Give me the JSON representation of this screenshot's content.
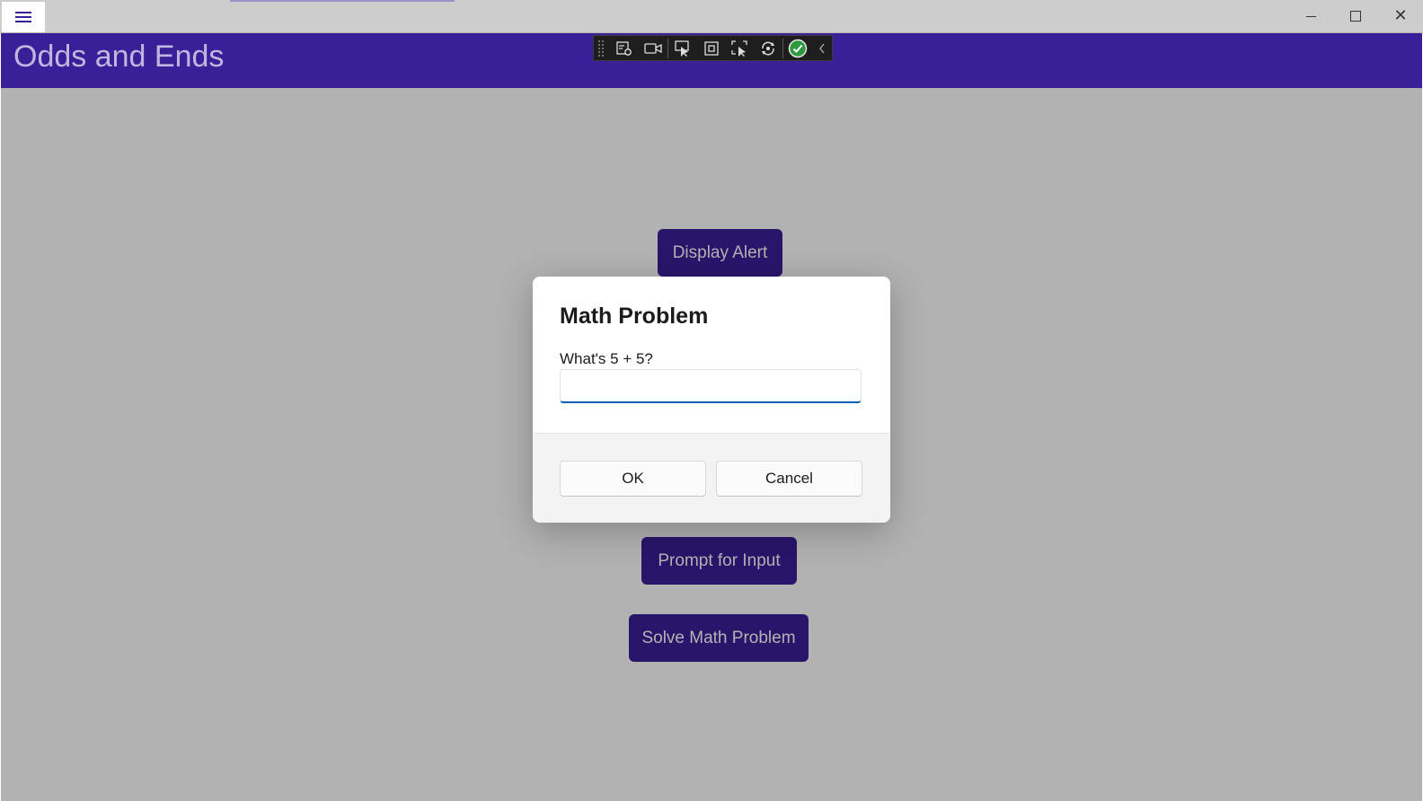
{
  "app": {
    "title": "Odds and Ends"
  },
  "window_controls": {
    "minimize_icon": "minimize-icon",
    "maximize_icon": "maximize-icon",
    "close_icon": "close-icon",
    "close_glyph": "✕"
  },
  "debug_toolbar": {
    "icons": [
      "live-visual-tree-icon",
      "record-icon",
      "select-element-icon",
      "display-layout-adorners-icon",
      "track-focus-icon",
      "hot-reload-icon",
      "accessibility-check-icon",
      "collapse-icon"
    ]
  },
  "buttons": {
    "display_alert": "Display Alert",
    "prompt_for_input": "Prompt for Input",
    "solve_math_problem": "Solve Math Problem"
  },
  "dialog": {
    "title": "Math Problem",
    "message": "What's 5 + 5?",
    "input_value": "",
    "ok_label": "OK",
    "cancel_label": "Cancel"
  },
  "colors": {
    "accent": "#3b1f98",
    "focus": "#005fb8"
  }
}
